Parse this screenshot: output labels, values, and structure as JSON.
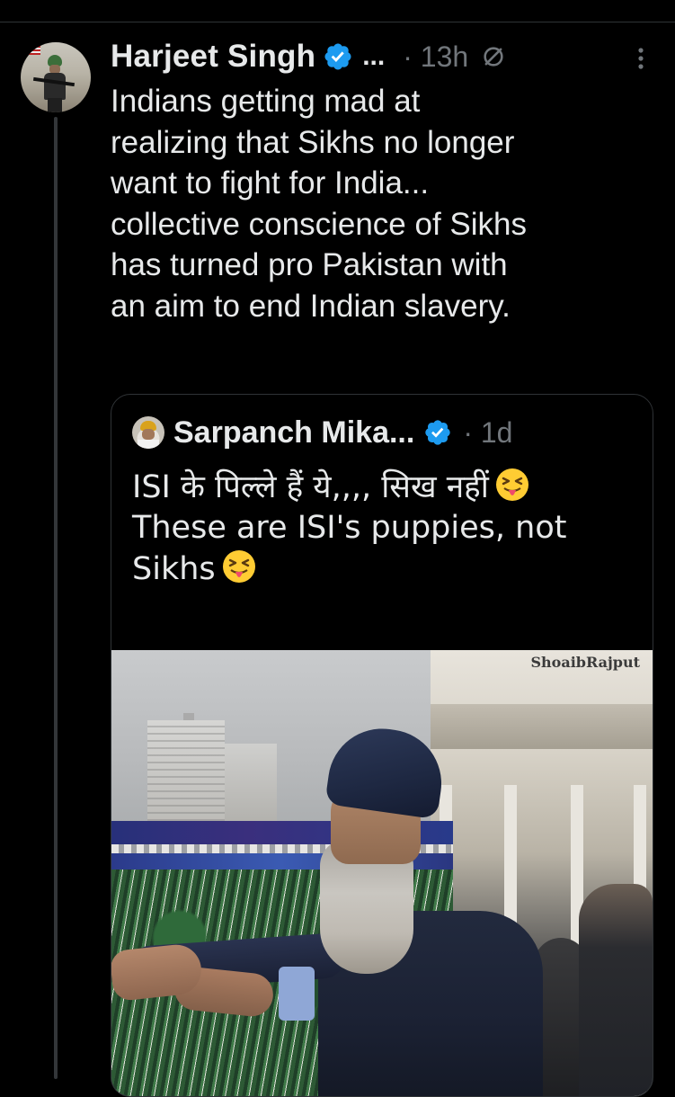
{
  "tweet": {
    "author_name": "Harjeet Singh",
    "truncation": "...",
    "time": "· 13h",
    "text": "Indians getting mad at\nrealizing that Sikhs no longer\nwant to fight for India...\ncollective conscience of Sikhs\nhas turned pro Pakistan with\nan aim to end Indian slavery."
  },
  "quote": {
    "author_name": "Sarpanch Mika...",
    "time": "· 1d",
    "line1": "ISI के पिल्ले हैं ये,,,, सिख नहीं",
    "line2": "These are ISI's puppies, not",
    "line3": "Sikhs",
    "media": {
      "watermark": "ShoaibRajput"
    }
  },
  "colors": {
    "background": "#000000",
    "text": "#e7e9ea",
    "muted": "#71767b",
    "verified": "#1d9bf0",
    "border": "#2f3336"
  },
  "icons": [
    "verified-badge-icon",
    "grok-icon",
    "more-options-icon",
    "squinting-tongue-emoji"
  ]
}
